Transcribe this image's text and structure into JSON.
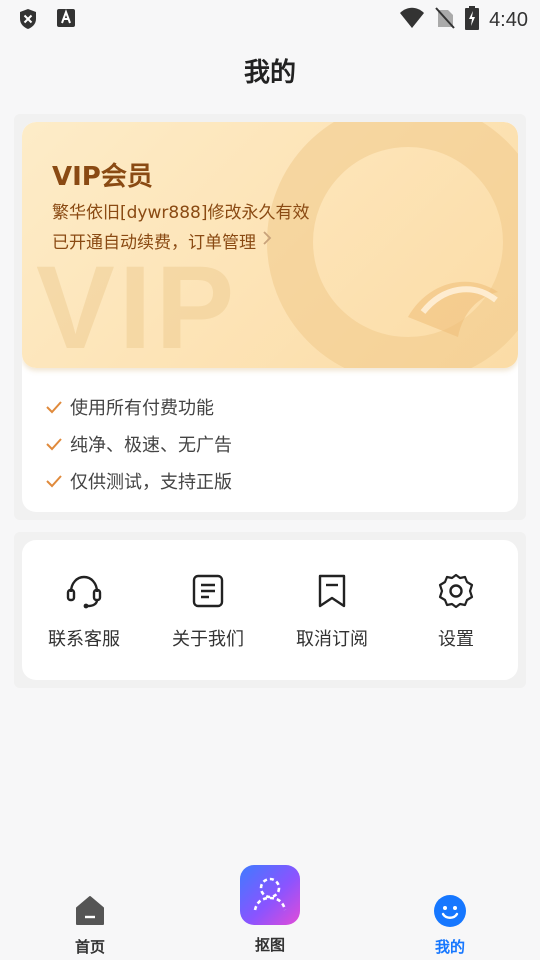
{
  "status_bar": {
    "time": "4:40",
    "icons": [
      "shield-x-icon",
      "font-a-icon",
      "wifi-icon",
      "no-sim-icon",
      "battery-charging-icon"
    ]
  },
  "header": {
    "title": "我的"
  },
  "vip": {
    "title": "VIP会员",
    "line1": "繁华依旧[dywr888]修改永久有效",
    "line2": "已开通自动续费，订单管理",
    "watermark": "VIP",
    "benefits": [
      "使用所有付费功能",
      "纯净、极速、无广告",
      "仅供测试，支持正版"
    ],
    "colors": {
      "text": "#8a4a13",
      "check": "#e08a3c",
      "card": "#fde3b5"
    }
  },
  "menu": {
    "items": [
      {
        "label": "联系客服",
        "icon": "headset-icon"
      },
      {
        "label": "关于我们",
        "icon": "document-icon"
      },
      {
        "label": "取消订阅",
        "icon": "bookmark-icon"
      },
      {
        "label": "设置",
        "icon": "gear-icon"
      }
    ]
  },
  "bottom_nav": {
    "items": [
      {
        "label": "首页",
        "icon": "home-icon"
      },
      {
        "label": "抠图",
        "icon": "cutout-icon"
      },
      {
        "label": "我的",
        "icon": "smile-icon",
        "active": true
      }
    ],
    "active_color": "#1677ff"
  }
}
